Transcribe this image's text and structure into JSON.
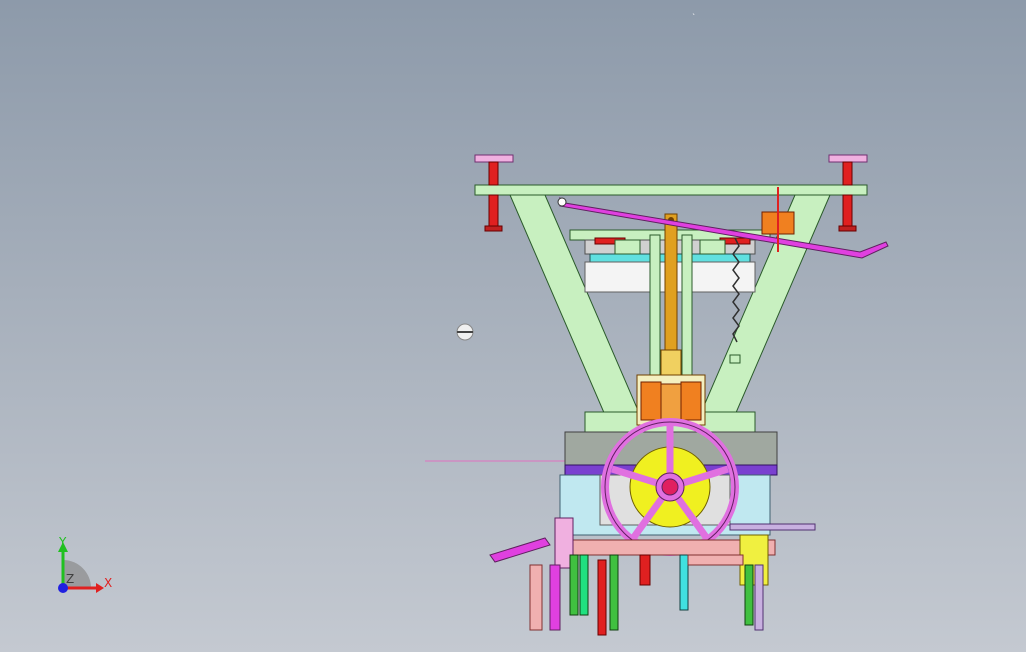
{
  "viewport": {
    "background_top": "#8d9aaa",
    "background_bottom": "#c4c9d1"
  },
  "model": {
    "colors": {
      "frame": "#c8f0c0",
      "frame_edge": "#2a5a2a",
      "lever": "#e040e0",
      "column": "#e0a020",
      "bracket": "#f08020",
      "handwheel": "#e070e0",
      "hub": "#f0f020",
      "base": "#7a40d0",
      "bolt": "#e02020",
      "pad": "#f0b0e0"
    }
  },
  "triad": {
    "x_label": "X",
    "y_label": "Y",
    "z_label": "Z",
    "x_color": "#e02020",
    "y_color": "#20c020",
    "z_color": "#2020e0"
  },
  "icons": {
    "view_cube": "rotation-sphere-icon"
  }
}
